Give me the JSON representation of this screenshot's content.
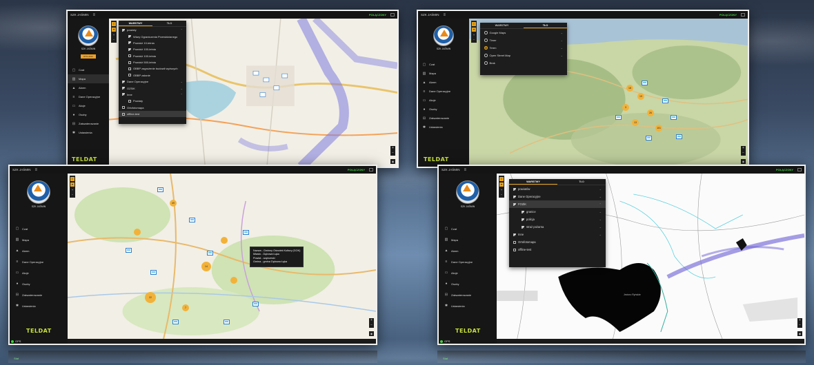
{
  "app": {
    "title": "SZK JAŚMIN",
    "connection_status": "POŁĄCZONY",
    "logo_text": "SZK JAŚMIN",
    "vendor_logo": "TELDAT",
    "status_badge": "RYS 2012",
    "gps_label": "GPS",
    "reflection_label": "Stat"
  },
  "nav": {
    "items": [
      {
        "label": "Czat",
        "icon": "chat-icon"
      },
      {
        "label": "Mapa",
        "icon": "map-icon"
      },
      {
        "label": "Alarm",
        "icon": "bell-icon"
      },
      {
        "label": "Dane Operacyjne",
        "icon": "database-icon"
      },
      {
        "label": "Akcje",
        "icon": "calendar-icon"
      },
      {
        "label": "Osoby",
        "icon": "person-icon"
      },
      {
        "label": "Zakwaterowanie",
        "icon": "bed-icon"
      },
      {
        "label": "Ustawienia",
        "icon": "gear-icon"
      }
    ]
  },
  "layer_tabs": {
    "layers": "WARSTWY",
    "background": "TŁO"
  },
  "panel_a": {
    "group": "powiaty",
    "rows": [
      {
        "label": "Wiary Ograniczenia Przewidzianego",
        "checked": true,
        "level": 1
      },
      {
        "label": "Powódź 10-letnia",
        "checked": true,
        "level": 1
      },
      {
        "label": "Powódź 100-letnia",
        "checked": true,
        "level": 1
      },
      {
        "label": "Powódź 100-letnia",
        "checked": false,
        "level": 1
      },
      {
        "label": "Powódź 500-letnia",
        "checked": false,
        "level": 1
      },
      {
        "label": "OBBP zagrożenie budowli wyższych",
        "checked": false,
        "level": 1
      },
      {
        "label": "OBBP zalanie",
        "checked": false,
        "level": 1
      },
      {
        "label": "Dane Operacyjne",
        "checked": true,
        "level": 0
      },
      {
        "label": "OZSiK",
        "checked": true,
        "level": 0
      },
      {
        "label": "Inne",
        "checked": true,
        "level": 0
      },
      {
        "label": "Powiaty",
        "checked": false,
        "level": 1
      },
      {
        "label": "Ortofotomapa",
        "checked": false,
        "level": 0
      },
      {
        "label": "offline-test",
        "checked": false,
        "level": 0,
        "selected": true
      }
    ]
  },
  "panel_b": {
    "options": [
      {
        "label": "Google Maps",
        "selected": false
      },
      {
        "label": "Timer",
        "selected": false
      },
      {
        "label": "Teren",
        "selected": true
      },
      {
        "label": "Open Street Map",
        "selected": false
      },
      {
        "label": "Brak",
        "selected": false
      }
    ]
  },
  "panel_d": {
    "rows": [
      {
        "label": "powiatów",
        "checked": true,
        "level": 0,
        "expandable": true
      },
      {
        "label": "Dane Operacyjne",
        "checked": true,
        "level": 0,
        "expandable": true
      },
      {
        "label": "FOZiK",
        "checked": true,
        "level": 0,
        "expandable": true,
        "selected": true
      },
      {
        "label": "granice",
        "checked": true,
        "level": 1,
        "expandable": true
      },
      {
        "label": "policja",
        "checked": true,
        "level": 1,
        "expandable": true
      },
      {
        "label": "straż pożarna",
        "checked": true,
        "level": 1,
        "expandable": true
      },
      {
        "label": "Inne",
        "checked": true,
        "level": 0,
        "expandable": true
      },
      {
        "label": "Ortofotomapa",
        "checked": false,
        "level": 0,
        "expandable": false
      },
      {
        "label": "offline-test",
        "checked": false,
        "level": 0,
        "expandable": false
      }
    ]
  },
  "tooltip": {
    "lines": [
      "Nazwa - Gminny Ośrodek Kultury (GOK)",
      "Miasto - Dębowa Łąka",
      "Powiat - wąbrzeski",
      "Gmina - gmina Dębowa Łąka"
    ]
  },
  "map_d_label": "Jezioro Ryńskie",
  "cluster_labels": [
    "18",
    "19",
    "3",
    "26",
    "13",
    "101",
    "49",
    "14",
    "22",
    "7"
  ]
}
